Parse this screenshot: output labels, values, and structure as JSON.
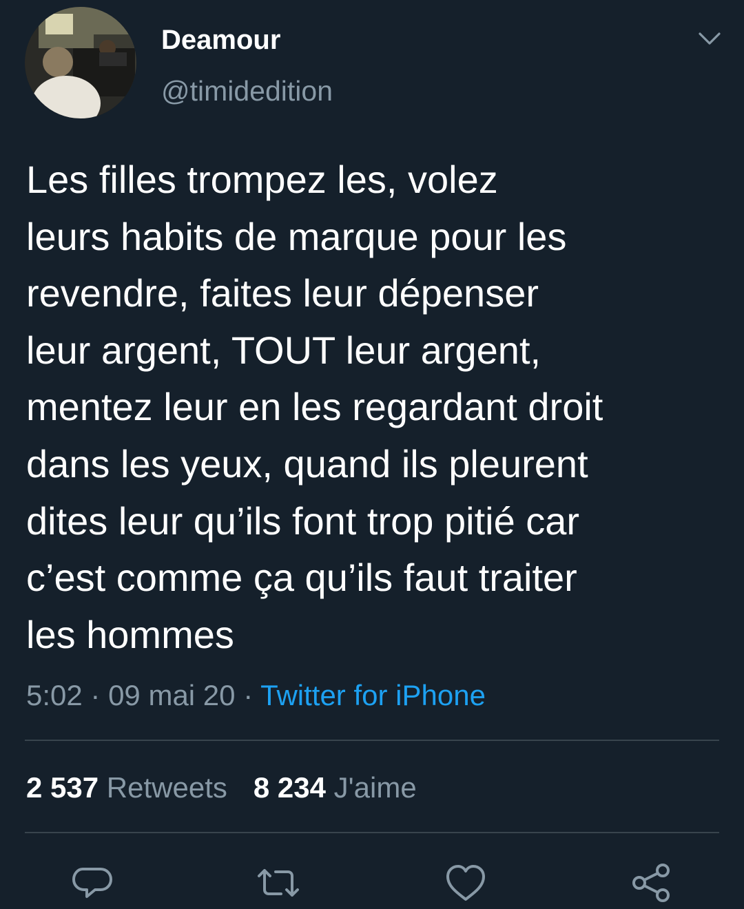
{
  "author": {
    "display_name": "Deamour",
    "handle": "@timidedition"
  },
  "tweet": {
    "lines": [
      "Les filles trompez les, volez",
      "leurs habits de marque pour les",
      "revendre, faites leur dépenser",
      "leur argent, TOUT leur argent,",
      "mentez leur en les regardant droit",
      "dans les yeux, quand ils pleurent",
      "dites leur qu’ils font trop pitié car",
      "c’est comme ça qu’ils faut traiter",
      "les hommes"
    ],
    "time": "5:02",
    "date": "09 mai 20",
    "separator": " · ",
    "source": "Twitter for iPhone"
  },
  "stats": {
    "retweets_count": "2 537",
    "retweets_label": "Retweets",
    "likes_count": "8 234",
    "likes_label": "J'aime"
  },
  "icons": {
    "menu": "chevron-down-icon",
    "reply": "reply-icon",
    "retweet": "retweet-icon",
    "like": "heart-icon",
    "share": "share-icon"
  },
  "colors": {
    "background": "#15202b",
    "text": "#ffffff",
    "secondary": "#8899a6",
    "link": "#1da1f2",
    "divider": "#38444d"
  }
}
